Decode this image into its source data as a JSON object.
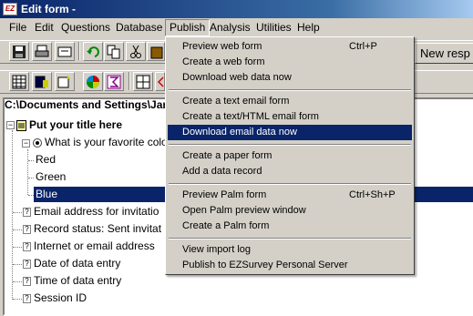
{
  "window": {
    "title": "Edit form -",
    "app_icon_text": "EZ"
  },
  "menubar": {
    "items": [
      {
        "label": "File"
      },
      {
        "label": "Edit"
      },
      {
        "label": "Questions"
      },
      {
        "label": "Database"
      },
      {
        "label": "Publish"
      },
      {
        "label": "Analysis"
      },
      {
        "label": "Utilities"
      },
      {
        "label": "Help"
      }
    ],
    "open_menu": "Publish"
  },
  "toolbar": {
    "new_response_label": "New resp"
  },
  "form": {
    "path": "C:\\Documents and Settings\\Jar",
    "title": "Put your title here",
    "question": "What is your favorite colo",
    "options": [
      "Red",
      "Green",
      "Blue"
    ],
    "selected_option": "Blue",
    "fields": [
      "Email address for invitatio",
      "Record status: Sent invitat",
      "Internet or email address",
      "Date of data entry",
      "Time of data entry",
      "Session ID"
    ],
    "field_icon": "?"
  },
  "publish_menu": {
    "groups": [
      [
        {
          "label": "Preview web form",
          "shortcut": "Ctrl+P"
        },
        {
          "label": "Create a web form",
          "shortcut": ""
        },
        {
          "label": "Download web data now",
          "shortcut": ""
        }
      ],
      [
        {
          "label": "Create a text email form",
          "shortcut": ""
        },
        {
          "label": "Create a text/HTML email form",
          "shortcut": ""
        },
        {
          "label": "Download email data now",
          "shortcut": "",
          "highlighted": true
        }
      ],
      [
        {
          "label": "Create a paper form",
          "shortcut": ""
        },
        {
          "label": "Add a data record",
          "shortcut": ""
        }
      ],
      [
        {
          "label": "Preview Palm form",
          "shortcut": "Ctrl+Sh+P"
        },
        {
          "label": "Open Palm preview window",
          "shortcut": ""
        },
        {
          "label": "Create a Palm form",
          "shortcut": ""
        }
      ],
      [
        {
          "label": "View import log",
          "shortcut": ""
        },
        {
          "label": "Publish to EZSurvey Personal Server",
          "shortcut": ""
        }
      ]
    ]
  },
  "colors": {
    "selection": "#0a246a",
    "titlebar": "#0a246a",
    "chrome": "#d4d0c8"
  }
}
